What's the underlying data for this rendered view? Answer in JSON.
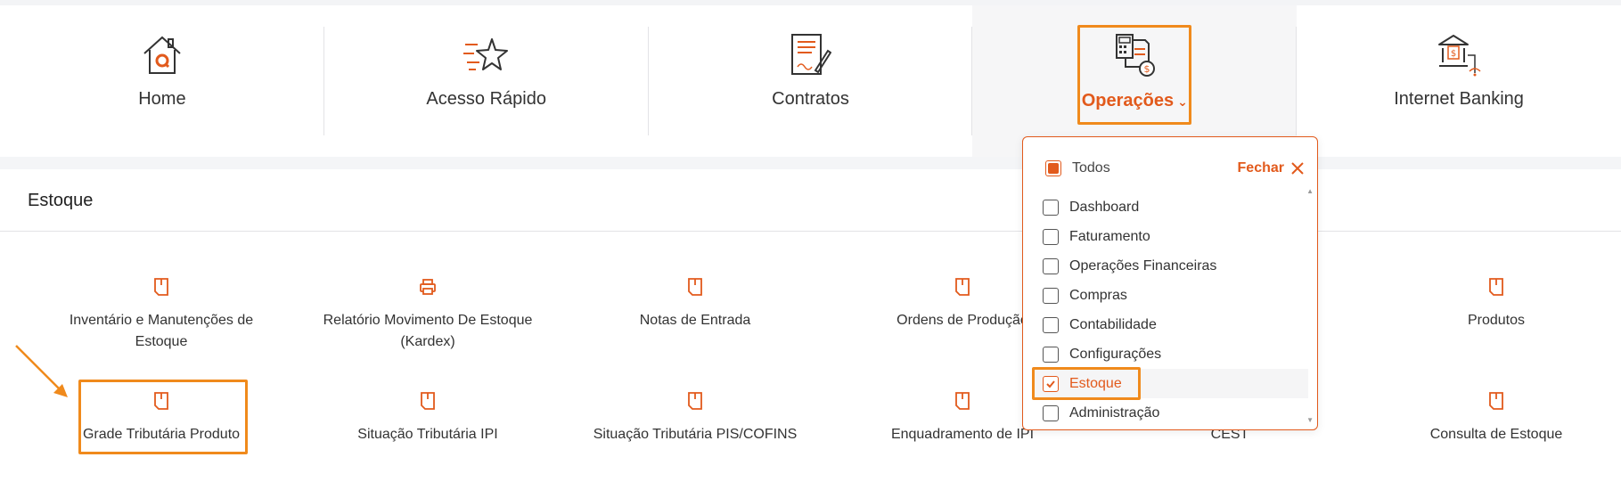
{
  "nav": {
    "items": [
      {
        "label": "Home",
        "icon": "home-icon"
      },
      {
        "label": "Acesso Rápido",
        "icon": "star-icon"
      },
      {
        "label": "Contratos",
        "icon": "contract-icon"
      },
      {
        "label": "Operações",
        "icon": "calculator-document-icon"
      },
      {
        "label": "Internet Banking",
        "icon": "bank-icon"
      }
    ],
    "active_index": 3
  },
  "section": {
    "title": "Estoque"
  },
  "modules": [
    {
      "label": "Inventário e Manutenções de Estoque",
      "icon": "document-icon"
    },
    {
      "label": "Relatório Movimento De Estoque (Kardex)",
      "icon": "printer-icon"
    },
    {
      "label": "Notas de Entrada",
      "icon": "document-icon"
    },
    {
      "label": "Ordens de Produção",
      "icon": "document-icon"
    },
    {
      "label": "Produtos",
      "icon": "document-icon"
    },
    {
      "label": "Grade Tributária Produto",
      "icon": "document-icon"
    },
    {
      "label": "Situação Tributária IPI",
      "icon": "document-icon"
    },
    {
      "label": "Situação Tributária PIS/COFINS",
      "icon": "document-icon"
    },
    {
      "label": "Enquadramento de IPI",
      "icon": "document-icon"
    },
    {
      "label": "CEST",
      "icon": "document-icon"
    },
    {
      "label": "Consulta de Estoque",
      "icon": "document-icon"
    }
  ],
  "dropdown": {
    "all_label": "Todos",
    "close_label": "Fechar",
    "options": [
      {
        "label": "Dashboard",
        "checked": false
      },
      {
        "label": "Faturamento",
        "checked": false
      },
      {
        "label": "Operações Financeiras",
        "checked": false
      },
      {
        "label": "Compras",
        "checked": false
      },
      {
        "label": "Contabilidade",
        "checked": false
      },
      {
        "label": "Configurações",
        "checked": false
      },
      {
        "label": "Estoque",
        "checked": true
      },
      {
        "label": "Administração",
        "checked": false
      }
    ]
  },
  "colors": {
    "accent": "#e25a1c",
    "highlight": "#f08a1c",
    "text": "#333333"
  }
}
